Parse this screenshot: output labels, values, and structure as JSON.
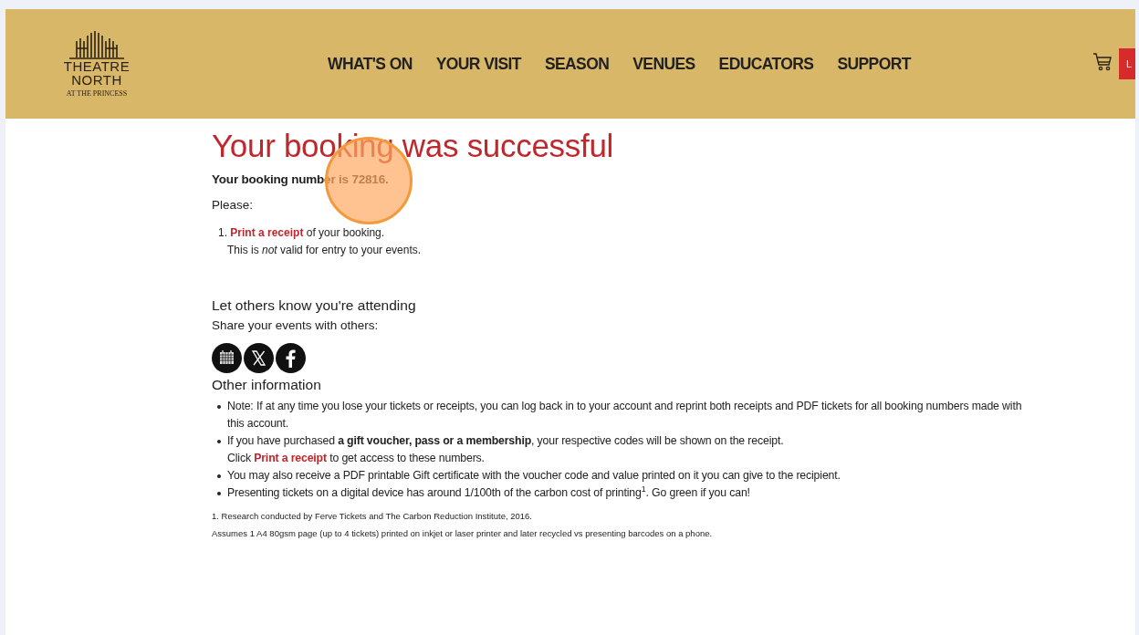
{
  "header": {
    "logo": {
      "line1": "THEATRE",
      "line2": "NORTH",
      "line3": "AT THE PRINCESS"
    },
    "nav": [
      "WHAT'S ON",
      "YOUR VISIT",
      "SEASON",
      "VENUES",
      "EDUCATORS",
      "SUPPORT"
    ],
    "cut_button": "L"
  },
  "title": "Your booking was successful",
  "booking_line": "Your booking number is 72816.",
  "please": "Please:",
  "steps": [
    {
      "number": "1.",
      "link": "Print a receipt",
      "after": "of your booking.",
      "note": "This is *not* valid for entry to your events."
    }
  ],
  "share": {
    "heading": "Let others know you're attending",
    "text": "Share your events with others:",
    "icons": [
      {
        "kind": "calendar"
      },
      {
        "kind": "x"
      },
      {
        "kind": "facebook"
      }
    ]
  },
  "other": {
    "heading": "Other information",
    "items": [
      {
        "text": "Note: If at any time you lose your tickets or receipts, you can log back in to your account and reprint both receipts and PDF tickets for all booking numbers made with this account."
      },
      {
        "text": "If you have purchased **a gift voucher, pass or a membership**, your respective codes will be shown on the receipt.",
        "before": "Click",
        "link": "Print a receipt",
        "after": "to get access to these numbers."
      },
      {
        "text": "You may also receive a PDF printable Gift certificate with the voucher code and value printed on it you can give to the recipient."
      },
      {
        "text": "Presenting tickets on a digital device has around 1/100th of the carbon cost of printing$^{1}$. Go green if you can!"
      }
    ]
  },
  "footnotes": [
    "1. Research conducted by Ferve Tickets and The Carbon Reduction Institute, 2016.",
    "Assumes 1 A4 80gsm page (up to 4 tickets) printed on inkjet or laser printer and later recycled vs presenting barcodes on a phone."
  ]
}
